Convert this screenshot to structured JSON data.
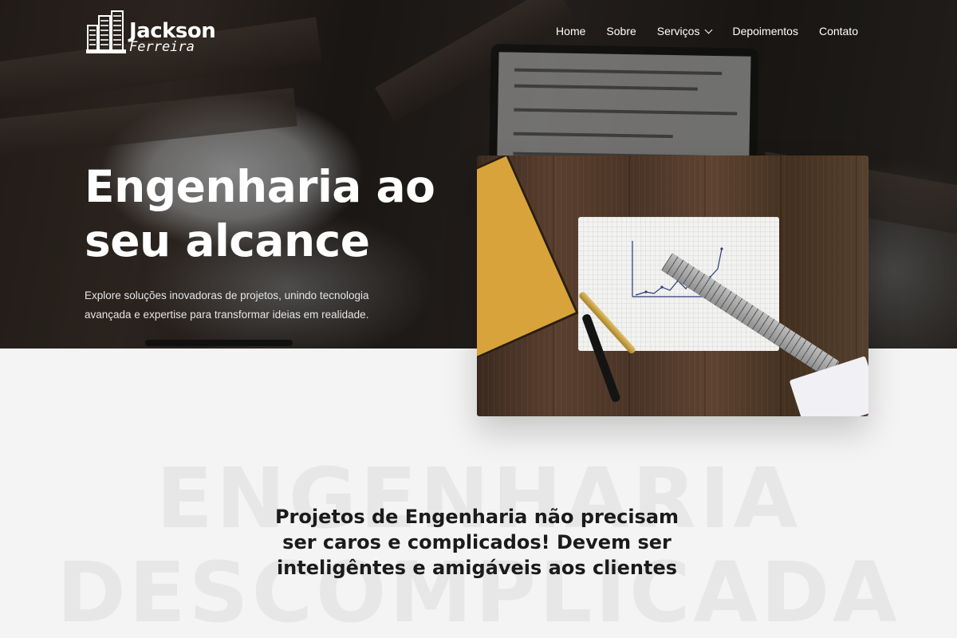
{
  "brand": {
    "name": "Jackson",
    "sub": "Ferreira"
  },
  "nav": {
    "items": [
      {
        "label": "Home"
      },
      {
        "label": "Sobre"
      },
      {
        "label": "Serviços",
        "has_dropdown": true
      },
      {
        "label": "Depoimentos"
      },
      {
        "label": "Contato"
      }
    ]
  },
  "hero": {
    "title_line1": "Engenharia ao",
    "title_line2": "seu alcance",
    "description": "Explore soluções inovadoras de projetos, unindo tecnologia avançada e expertise para transformar ideias em realidade."
  },
  "section": {
    "watermark_line1": "ENGENHARIA",
    "watermark_line2": "DESCOMPLICADA",
    "heading": "Projetos de Engenharia não precisam ser caros e complicados! Devem ser inteligêntes e amigáveis aos clientes"
  },
  "colors": {
    "background": "#f3f4f3",
    "text_dark": "#1b1b1b",
    "hero_text": "#ffffff",
    "watermark": "#e6e7e6"
  },
  "icons": {
    "logo": "buildings-logo-icon",
    "dropdown": "chevron-down-icon"
  }
}
